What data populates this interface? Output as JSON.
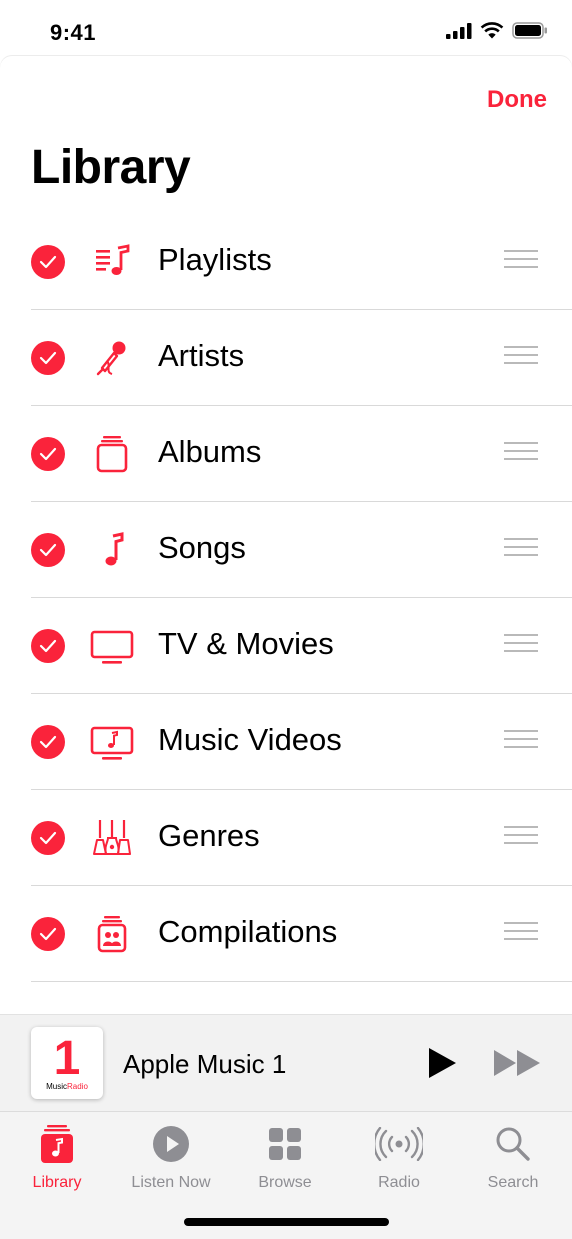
{
  "status": {
    "time": "9:41"
  },
  "header": {
    "done_label": "Done",
    "title": "Library"
  },
  "library_items": [
    {
      "label": "Playlists",
      "icon": "playlist-icon",
      "checked": true
    },
    {
      "label": "Artists",
      "icon": "microphone-icon",
      "checked": true
    },
    {
      "label": "Albums",
      "icon": "albums-icon",
      "checked": true
    },
    {
      "label": "Songs",
      "icon": "music-note-icon",
      "checked": true
    },
    {
      "label": "TV & Movies",
      "icon": "tv-icon",
      "checked": true
    },
    {
      "label": "Music Videos",
      "icon": "music-video-icon",
      "checked": true
    },
    {
      "label": "Genres",
      "icon": "guitars-icon",
      "checked": true
    },
    {
      "label": "Compilations",
      "icon": "compilations-icon",
      "checked": true
    }
  ],
  "now_playing": {
    "art_number": "1",
    "art_brand_prefix": "Music",
    "art_brand_suffix": "Radio",
    "title": "Apple Music 1"
  },
  "tabs": [
    {
      "label": "Library",
      "icon": "library-icon",
      "active": true
    },
    {
      "label": "Listen Now",
      "icon": "play-circle-icon",
      "active": false
    },
    {
      "label": "Browse",
      "icon": "grid-icon",
      "active": false
    },
    {
      "label": "Radio",
      "icon": "radio-icon",
      "active": false
    },
    {
      "label": "Search",
      "icon": "search-icon",
      "active": false
    }
  ],
  "colors": {
    "accent": "#fa233b",
    "inactive": "#8e8e93"
  }
}
